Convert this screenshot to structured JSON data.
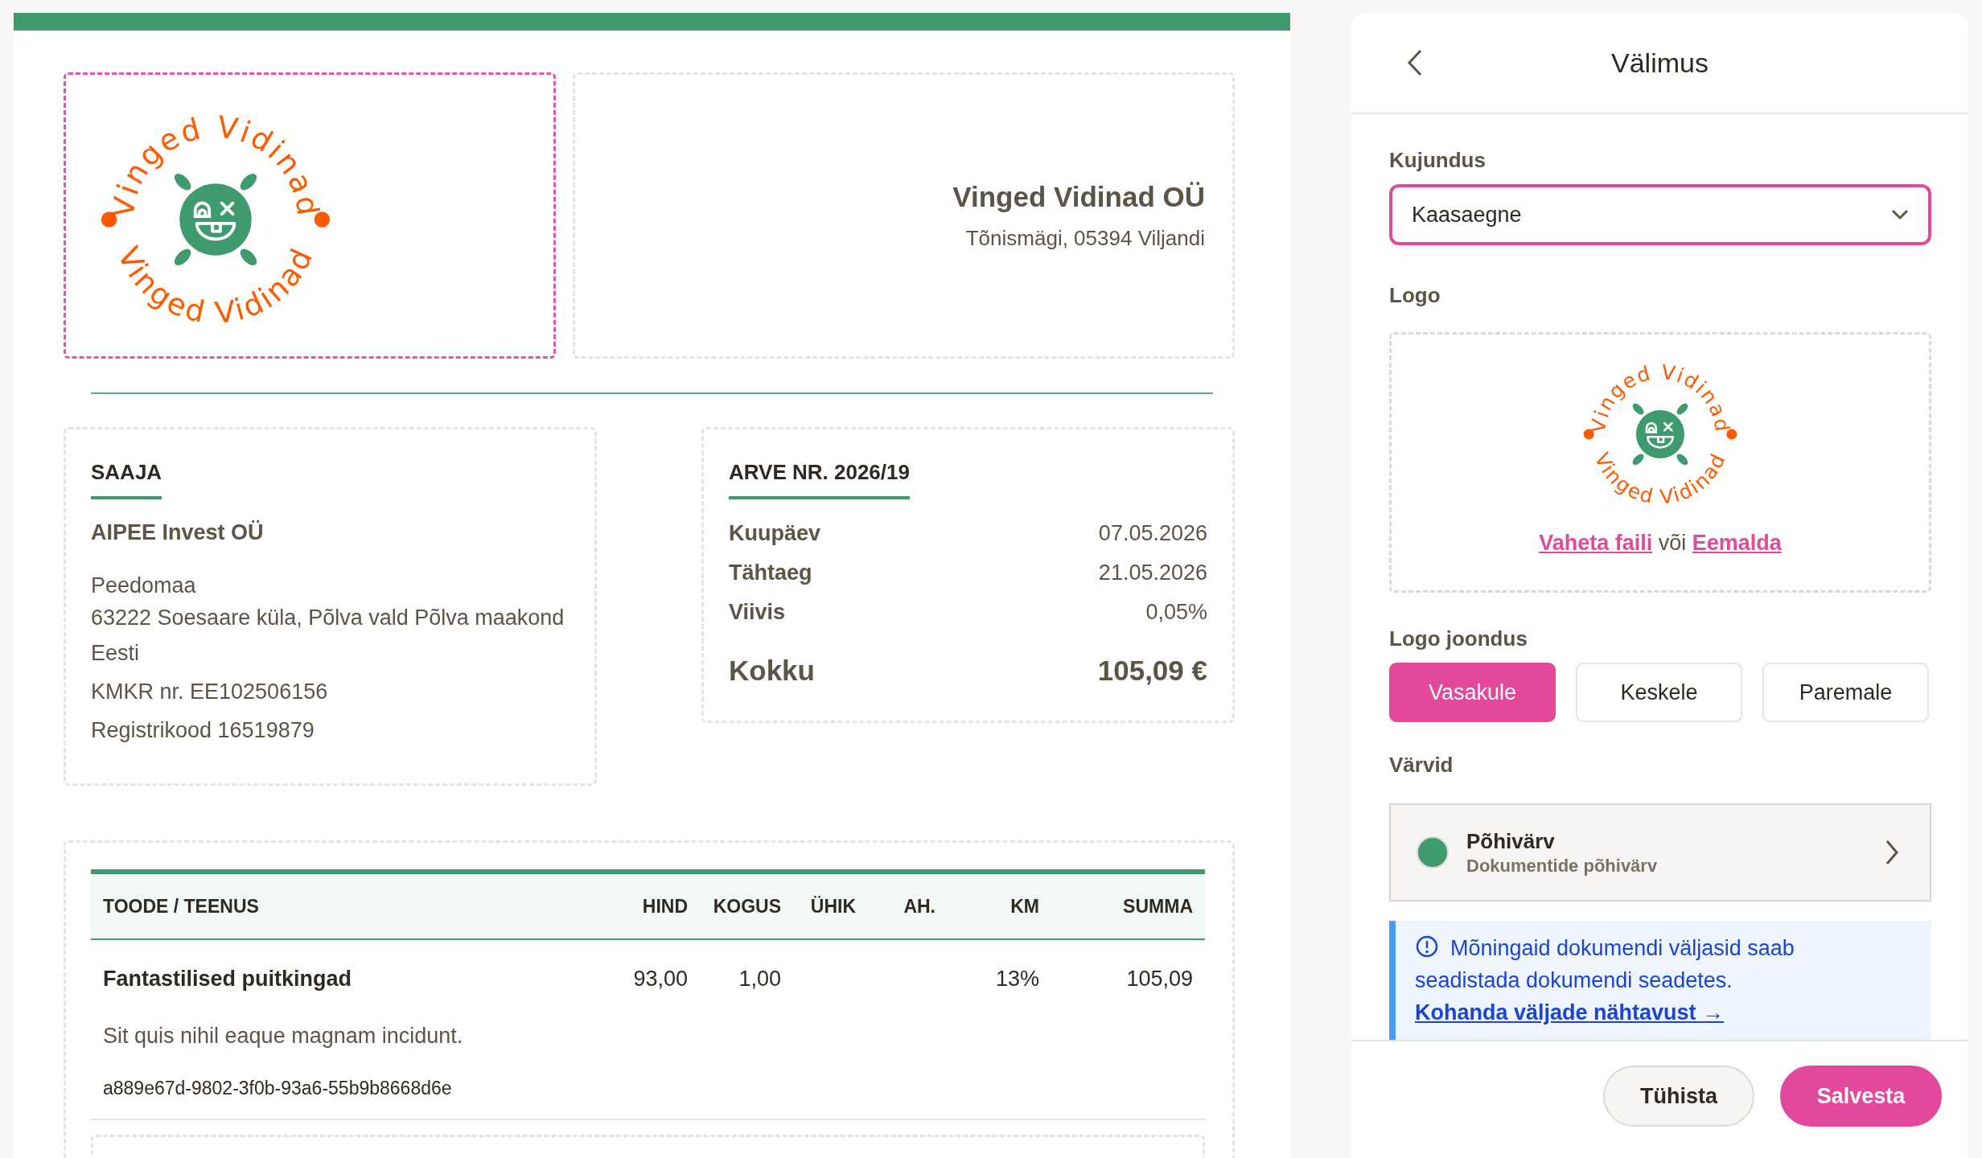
{
  "invoice": {
    "header": {
      "logo": {
        "arc_texts": [
          "Vinged Vidinad",
          "Vinged Vidinad"
        ]
      },
      "company_name": "Vinged Vidinad OÜ",
      "company_address": "Tõnismägi, 05394 Viljandi"
    },
    "recipient": {
      "heading": "SAAJA",
      "name": "AIPEE Invest OÜ",
      "address_lines": [
        "Peedomaa",
        "63222 Soesaare küla, Põlva vald Põlva maakond"
      ],
      "lines": [
        "Eesti",
        "KMKR nr. EE102506156",
        "Registrikood 16519879"
      ]
    },
    "summary": {
      "heading": "ARVE NR. 2026/19",
      "rows": [
        {
          "label": "Kuupäev",
          "value": "07.05.2026"
        },
        {
          "label": "Tähtaeg",
          "value": "21.05.2026"
        },
        {
          "label": "Viivis",
          "value": "0,05%"
        }
      ],
      "total": {
        "label": "Kokku",
        "value": "105,09 €"
      }
    },
    "table": {
      "columns": [
        "TOODE / TEENUS",
        "HIND",
        "KOGUS",
        "ÜHIK",
        "AH.",
        "KM",
        "SUMMA"
      ],
      "rows": [
        {
          "cells": [
            "Fantastilised puitkingad",
            "93,00",
            "1,00",
            null,
            null,
            "13%",
            "105,09"
          ],
          "description": "Sit quis nihil eaque magnam incidunt.",
          "code": "a889e67d-9802-3f0b-93a6-55b9b8668d6e"
        }
      ]
    }
  },
  "panel": {
    "title": "Välimus",
    "design": {
      "label": "Kujundus",
      "value": "Kaasaegne"
    },
    "logo": {
      "label": "Logo",
      "arc_texts": [
        "Vinged Vidinad",
        "Vinged Vidinad"
      ],
      "actions": [
        "Vaheta faili",
        "Eemalda"
      ],
      "separator": "või"
    },
    "alignment": {
      "label": "Logo joondus",
      "options": [
        {
          "label": "Vasakule",
          "selected": true
        },
        {
          "label": "Keskele",
          "selected": false
        },
        {
          "label": "Paremale",
          "selected": false
        }
      ]
    },
    "colors": {
      "label": "Värvid",
      "items": [
        {
          "name": "Põhivärv",
          "description": "Dokumentide põhivärv",
          "color": "#3f9a6e"
        }
      ]
    },
    "info": {
      "text": "Mõningaid dokumendi väljasid saab seadistada dokumendi seadetes.",
      "link": "Kohanda väljade nähtavust →"
    },
    "buttons": [
      {
        "label": "Tühista",
        "kind": "secondary"
      },
      {
        "label": "Salvesta",
        "kind": "primary"
      }
    ]
  }
}
